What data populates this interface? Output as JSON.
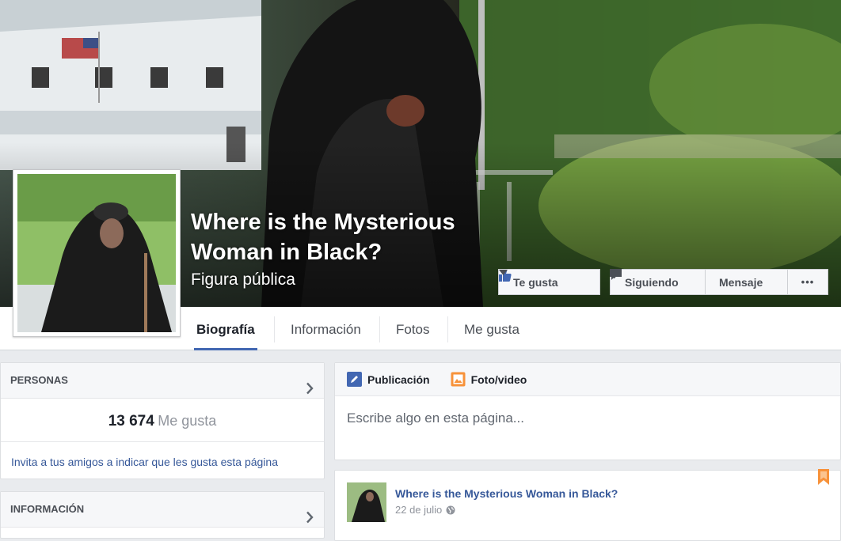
{
  "page": {
    "name": "Where is the Mysterious Woman in Black?",
    "category": "Figura pública"
  },
  "actions": {
    "like": "Te gusta",
    "following": "Siguiendo",
    "message": "Mensaje",
    "more": "•••"
  },
  "nav": {
    "tabs": [
      {
        "label": "Biografía",
        "active": true
      },
      {
        "label": "Información",
        "active": false
      },
      {
        "label": "Fotos",
        "active": false
      },
      {
        "label": "Me gusta",
        "active": false
      }
    ]
  },
  "people": {
    "header": "PERSONAS",
    "likes_count": "13 674",
    "likes_label": "Me gusta",
    "invite_text": "Invita a tus amigos a indicar que les gusta esta página"
  },
  "about": {
    "header": "INFORMACIÓN"
  },
  "composer": {
    "tabs": [
      {
        "label": "Publicación",
        "icon": "pencil-icon"
      },
      {
        "label": "Foto/video",
        "icon": "photo-icon"
      }
    ],
    "placeholder": "Escribe algo en esta página..."
  },
  "post": {
    "author": "Where is the Mysterious Woman in Black?",
    "date": "22 de julio",
    "privacy_icon": "globe-icon"
  },
  "colors": {
    "brand_blue": "#4267b2",
    "link_blue": "#365899",
    "bookmark_orange": "#f7923a"
  }
}
